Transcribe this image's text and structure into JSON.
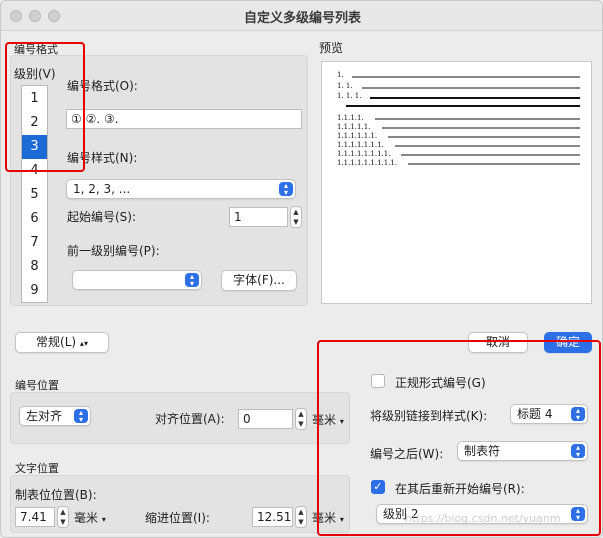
{
  "window": {
    "title": "自定义多级编号列表"
  },
  "numbering_format_section": {
    "title": "编号格式",
    "level_label": "级别(V)",
    "levels": [
      "1",
      "2",
      "3",
      "4",
      "5",
      "6",
      "7",
      "8",
      "9"
    ],
    "selected_level": "3",
    "format_label": "编号格式(O):",
    "format_value": "① ②. ③.",
    "style_label": "编号样式(N):",
    "style_value": "1, 2, 3, ...",
    "start_label": "起始编号(S):",
    "start_value": "1",
    "prev_level_label": "前一级别编号(P):",
    "prev_level_value": "",
    "font_button": "字体(F)..."
  },
  "preview": {
    "title": "预览",
    "lines": [
      "1.",
      "1. 1.",
      "1. 1. 1.",
      "1.1.1.1.",
      "1.1.1.1.1.",
      "1.1.1.1.1.1.",
      "1.1.1.1.1.1.1.",
      "1.1.1.1.1.1.1.1.",
      "1.1.1.1.1.1.1.1.1."
    ]
  },
  "mode_popup": {
    "label": "常规(L)",
    "arrow": "▴▾"
  },
  "actions": {
    "cancel": "取消",
    "ok": "确定"
  },
  "number_position": {
    "title": "编号位置",
    "align_value": "左对齐",
    "align_at_label": "对齐位置(A):",
    "align_at_value": "0",
    "unit": "毫米"
  },
  "text_position": {
    "title": "文字位置",
    "tab_label": "制表位位置(B):",
    "tab_value": "7.41",
    "tab_unit": "毫米",
    "indent_label": "缩进位置(I):",
    "indent_value": "12.51",
    "indent_unit": "毫米"
  },
  "options": {
    "legal_label": "正规形式编号(G)",
    "legal_checked": false,
    "link_label": "将级别链接到样式(K):",
    "link_value": "标题 4",
    "follow_label": "编号之后(W):",
    "follow_value": "制表符",
    "restart_label": "在其后重新开始编号(R):",
    "restart_checked": true,
    "restart_value": "级别 2"
  },
  "watermark": "https://blog.csdn.net/yuanm",
  "colors": {
    "accent": "#2d6fe6",
    "annotation": "#e80000"
  }
}
